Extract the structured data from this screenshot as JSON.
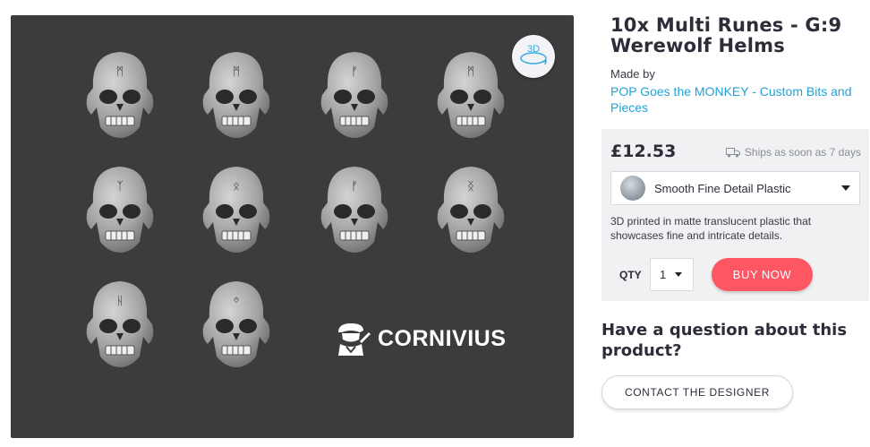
{
  "product": {
    "title": "10x Multi Runes - G:9 Werewolf Helms",
    "made_by_label": "Made by",
    "maker": "POP Goes the MONKEY - Custom Bits and Pieces"
  },
  "viewer": {
    "badge_3d_label": "3D",
    "brand_name": "CORNIVIUS",
    "helm_runes": [
      "ᛗ",
      "ᛗ",
      "ᚠ",
      "ᛗ",
      "ᛉ",
      "ᛟ",
      "ᚠ",
      "ᛝ",
      "ᚺ",
      "ᛜ"
    ]
  },
  "purchase": {
    "price": "£12.53",
    "shipping": "Ships as soon as 7 days",
    "material": "Smooth Fine Detail Plastic",
    "material_description": "3D printed in matte translucent plastic that showcases fine and intricate details.",
    "qty_label": "QTY",
    "qty_value": "1",
    "buy_label": "BUY NOW"
  },
  "contact": {
    "question": "Have a question about this product?",
    "button_label": "CONTACT THE DESIGNER"
  },
  "colors": {
    "accent_blue": "#22a3d6",
    "buy_red": "#ff5663",
    "viewer_bg": "#3c3c3c"
  },
  "icons": [
    "rotate-3d-icon",
    "truck-icon",
    "chevron-down-icon",
    "painter-logo-icon"
  ]
}
